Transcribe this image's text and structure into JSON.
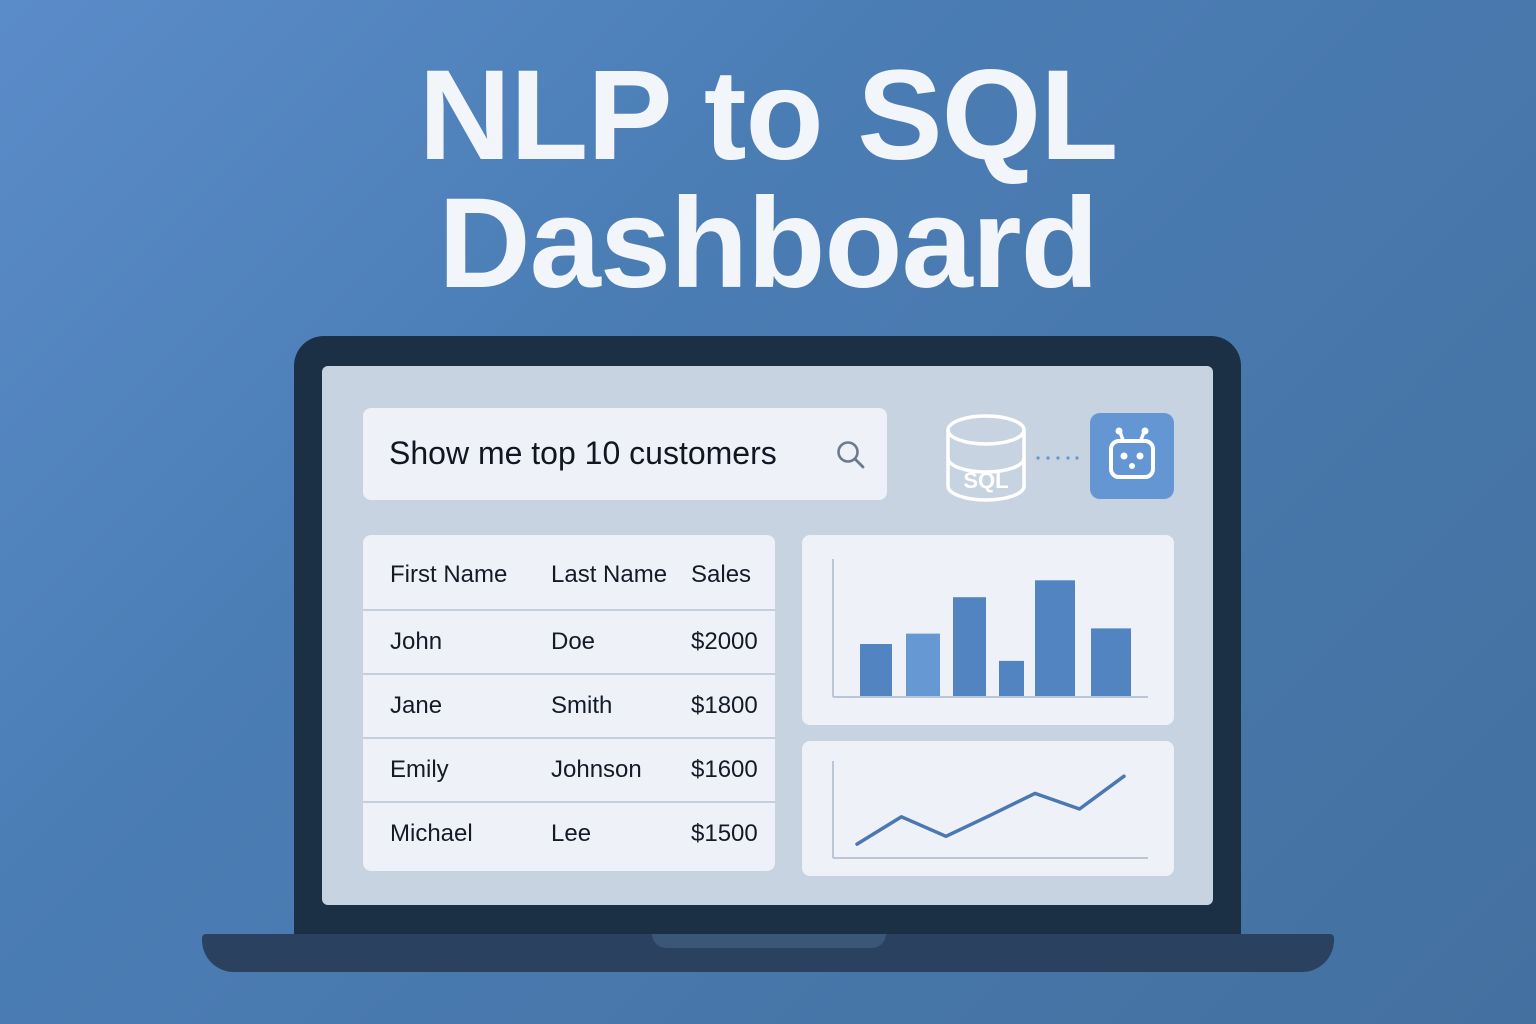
{
  "title": {
    "line1": "NLP to SQL",
    "line2": "Dashboard"
  },
  "search": {
    "query": "Show me top 10 customers",
    "icon": "search-icon"
  },
  "pipeline": {
    "database_label": "SQL",
    "database_icon": "database-icon",
    "bot_icon": "robot-icon"
  },
  "table": {
    "columns": [
      "First Name",
      "Last Name",
      "Sales"
    ],
    "rows": [
      [
        "John",
        "Doe",
        "$2000"
      ],
      [
        "Jane",
        "Smith",
        "$1800"
      ],
      [
        "Emily",
        "Johnson",
        "$1600"
      ],
      [
        "Michael",
        "Lee",
        "$1500"
      ]
    ]
  },
  "colors": {
    "background": "#4b7db5",
    "accent": "#6496d3",
    "bar": "#5284c2",
    "bar_highlight": "#6698d4",
    "line": "#4a78b2",
    "laptop": "#1b2f45"
  },
  "chart_data": [
    {
      "type": "bar",
      "values": [
        0.4,
        0.48,
        0.76,
        0.27,
        0.89,
        0.52
      ],
      "ylim": [
        0,
        1
      ],
      "grid": false
    },
    {
      "type": "line",
      "values": [
        0.05,
        0.4,
        0.15,
        0.42,
        0.7,
        0.5,
        0.92
      ],
      "ylim": [
        0,
        1
      ],
      "grid": false
    }
  ]
}
